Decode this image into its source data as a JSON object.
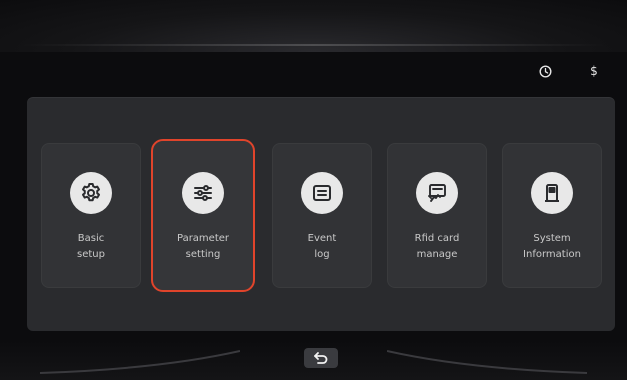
{
  "status_bar": {
    "icons": [
      "clock-icon",
      "currency-icon"
    ],
    "currency_symbol": "$"
  },
  "menu": {
    "items": [
      {
        "id": "basic-setup",
        "line1": "Basic",
        "line2": "setup",
        "icon": "gear-icon",
        "selected": false
      },
      {
        "id": "parameter-setting",
        "line1": "Parameter",
        "line2": "setting",
        "icon": "sliders-icon",
        "selected": true
      },
      {
        "id": "event-log",
        "line1": "Event",
        "line2": "log",
        "icon": "list-icon",
        "selected": false
      },
      {
        "id": "rfid-card-manage",
        "line1": "Rfid card",
        "line2": "manage",
        "icon": "card-swipe-icon",
        "selected": false
      },
      {
        "id": "system-information",
        "line1": "System",
        "line2": "Information",
        "icon": "fuel-pump-icon",
        "selected": false
      }
    ]
  },
  "footer": {
    "back_icon": "back-arrow-icon"
  },
  "colors": {
    "selection": "#e0442b",
    "panel": "#2a2b2e",
    "card": "#323336",
    "icon_bg": "#e8e8e8",
    "label": "#c9c9c9"
  }
}
